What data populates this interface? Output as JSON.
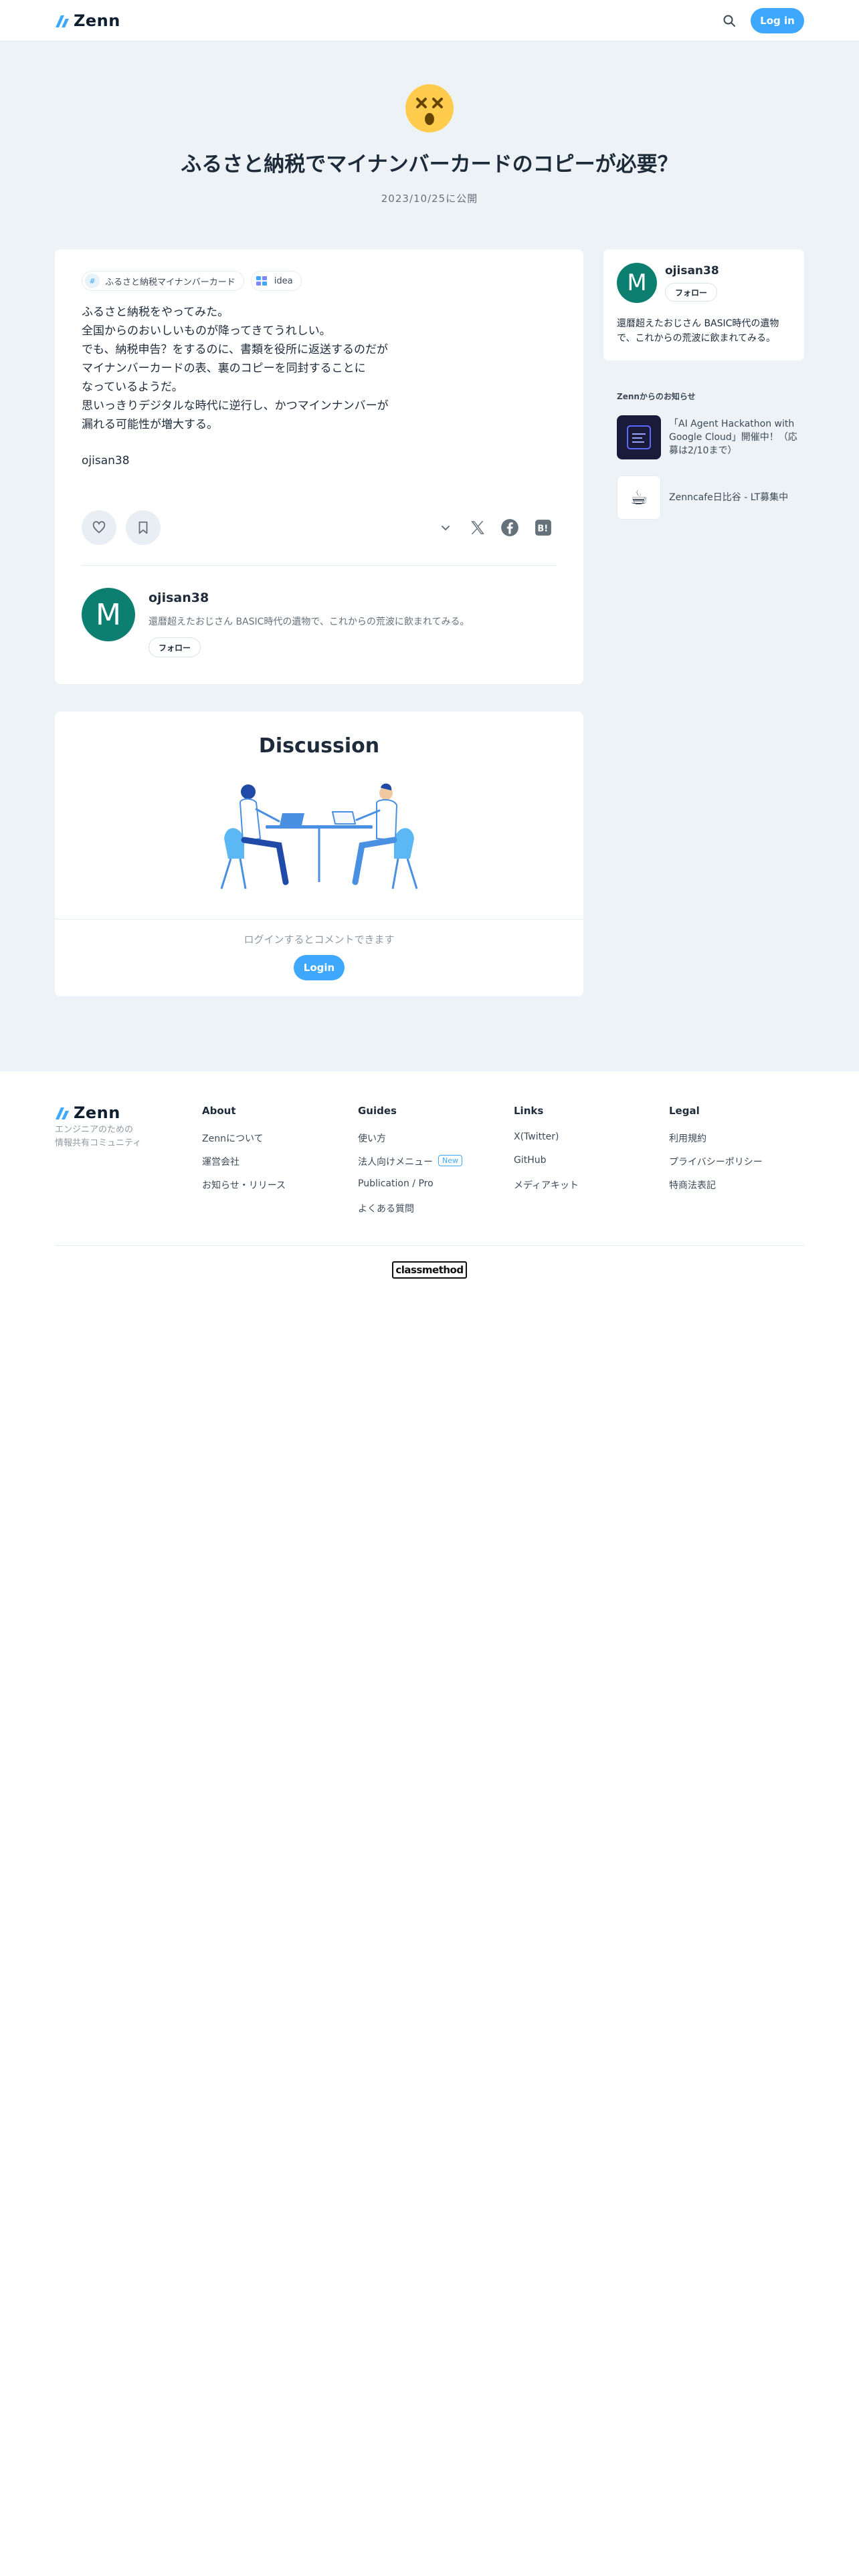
{
  "header": {
    "logo_text": "Zenn",
    "login_label": "Log in"
  },
  "article": {
    "title": "ふるさと納税でマイナンバーカードのコピーが必要？",
    "published": "2023/10/25に公開",
    "topics": [
      {
        "label": "ふるさと納税マイナンバーカード"
      },
      {
        "label": "idea"
      }
    ],
    "body": [
      "ふるさと納税をやってみた。",
      "全国からのおいしいものが降ってきてうれしい。",
      "でも、納税申告？をするのに、書類を役所に返送するのだが",
      "マイナンバーカードの表、裏のコピーを同封することに",
      "なっているようだ。",
      "思いっきりデジタルな時代に逆行し、かつマインナンバーが",
      "漏れる可能性が増大する。"
    ],
    "signature": "ojisan38"
  },
  "author": {
    "initial": "M",
    "name": "ojisan38",
    "bio": "還暦超えたおじさん BASIC時代の遺物で、これからの荒波に飲まれてみる。",
    "follow_label": "フォロー"
  },
  "discussion": {
    "title": "Discussion",
    "hint": "ログインするとコメントできます",
    "login_label": "Login"
  },
  "sidebar": {
    "news_heading": "Zennからのお知らせ",
    "news": [
      {
        "text": "「AI Agent Hackathon with Google Cloud」開催中！（応募は2/10まで）"
      },
      {
        "text": "Zenncafe日比谷 - LT募集中"
      }
    ]
  },
  "footer": {
    "logo_text": "Zenn",
    "tagline_1": "エンジニアのための",
    "tagline_2": "情報共有コミュニティ",
    "columns": [
      {
        "heading": "About",
        "links": [
          "Zennについて",
          "運営会社",
          "お知らせ・リリース"
        ]
      },
      {
        "heading": "Guides",
        "links": [
          "使い方",
          "法人向けメニュー",
          "Publication / Pro",
          "よくある質問"
        ],
        "new_badge": "New"
      },
      {
        "heading": "Links",
        "links": [
          "X(Twitter)",
          "GitHub",
          "メディアキット"
        ]
      },
      {
        "heading": "Legal",
        "links": [
          "利用規約",
          "プライバシーポリシー",
          "特商法表記"
        ]
      }
    ],
    "sponsor": "classmethod"
  },
  "colors": {
    "accent": "#3ea8ff",
    "background": "#edf2f7",
    "avatar": "#0d7f71"
  }
}
